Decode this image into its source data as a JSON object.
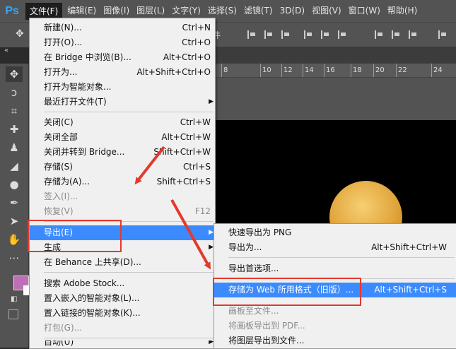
{
  "app": {
    "logo": "Ps"
  },
  "menubar": {
    "items": [
      "文件(F)",
      "编辑(E)",
      "图像(I)",
      "图层(L)",
      "文字(Y)",
      "选择(S)",
      "滤镜(T)",
      "3D(D)",
      "视图(V)",
      "窗口(W)",
      "帮助(H)"
    ]
  },
  "options_bar": {
    "partial_text": "件"
  },
  "ruler": {
    "labels": [
      "8",
      "10",
      "12",
      "14",
      "16",
      "18",
      "20",
      "22",
      "24"
    ]
  },
  "file_menu": {
    "items": [
      {
        "label": "新建(N)...",
        "shortcut": "Ctrl+N"
      },
      {
        "label": "打开(O)...",
        "shortcut": "Ctrl+O"
      },
      {
        "label": "在 Bridge 中浏览(B)...",
        "shortcut": "Alt+Ctrl+O"
      },
      {
        "label": "打开为...",
        "shortcut": "Alt+Shift+Ctrl+O"
      },
      {
        "label": "打开为智能对象...",
        "shortcut": ""
      },
      {
        "label": "最近打开文件(T)",
        "shortcut": ""
      },
      {
        "label": "关闭(C)",
        "shortcut": "Ctrl+W"
      },
      {
        "label": "关闭全部",
        "shortcut": "Alt+Ctrl+W"
      },
      {
        "label": "关闭并转到 Bridge...",
        "shortcut": "Shift+Ctrl+W"
      },
      {
        "label": "存储(S)",
        "shortcut": "Ctrl+S"
      },
      {
        "label": "存储为(A)...",
        "shortcut": "Shift+Ctrl+S"
      },
      {
        "label": "签入(I)...",
        "shortcut": ""
      },
      {
        "label": "恢复(V)",
        "shortcut": "F12"
      },
      {
        "label": "导出(E)",
        "shortcut": ""
      },
      {
        "label": "生成",
        "shortcut": ""
      },
      {
        "label": "在 Behance 上共享(D)...",
        "shortcut": ""
      },
      {
        "label": "搜索 Adobe Stock...",
        "shortcut": ""
      },
      {
        "label": "置入嵌入的智能对象(L)...",
        "shortcut": ""
      },
      {
        "label": "置入链接的智能对象(K)...",
        "shortcut": ""
      },
      {
        "label": "打包(G)...",
        "shortcut": ""
      },
      {
        "label": "自动(U)",
        "shortcut": ""
      }
    ]
  },
  "export_menu": {
    "items": [
      {
        "label": "快速导出为 PNG",
        "shortcut": ""
      },
      {
        "label": "导出为...",
        "shortcut": "Alt+Shift+Ctrl+W"
      },
      {
        "label": "导出首选项...",
        "shortcut": ""
      },
      {
        "label": "存储为 Web 所用格式（旧版）...",
        "shortcut": "Alt+Shift+Ctrl+S"
      },
      {
        "label": "画板至文件...",
        "shortcut": ""
      },
      {
        "label": "将画板导出到 PDF...",
        "shortcut": ""
      },
      {
        "label": "将图层导出到文件...",
        "shortcut": ""
      }
    ]
  },
  "colors": {
    "highlight": "#3b8bff",
    "annotation": "#e23a2c",
    "foreground": "#bf6fb6",
    "ball": "#e1a43b"
  }
}
